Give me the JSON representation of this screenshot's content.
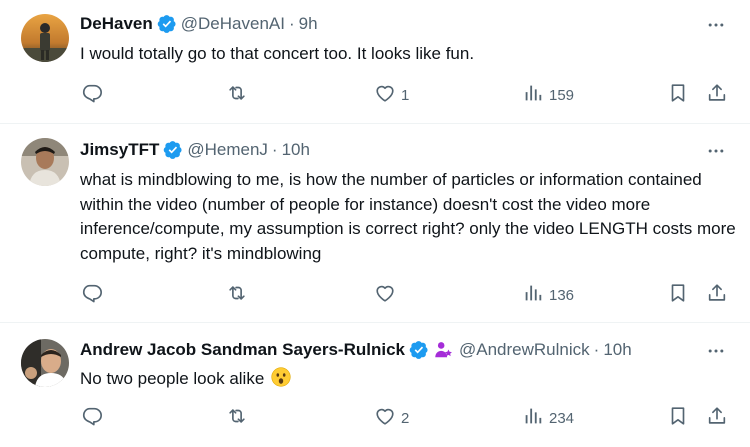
{
  "tweets": [
    {
      "name": "DeHaven",
      "handle": "@DeHavenAI",
      "time": "9h",
      "text": "I would totally go to that concert too. It looks like fun.",
      "likes": "1",
      "views": "159"
    },
    {
      "name": "JimsyTFT",
      "handle": "@HemenJ",
      "time": "10h",
      "text": "what is mindblowing to me, is how the number of particles or information contained within the video (number of people for instance) doesn't cost the video more inference/compute, my assumption is correct right? only the video LENGTH costs more compute, right? it's mindblowing",
      "likes": "",
      "views": "136"
    },
    {
      "name": "Andrew Jacob Sandman Sayers-Rulnick",
      "handle": "@AndrewRulnick",
      "time": "10h",
      "text": "No two people look alike",
      "emoji": "astonished-face",
      "likes": "2",
      "views": "234"
    }
  ],
  "separator": "·",
  "colors": {
    "text": "#0f1419",
    "secondary": "#536471",
    "verified": "#1d9bf0",
    "affiliate": "#a52dd8",
    "divider": "#eff3f4"
  },
  "icons": [
    "verified-badge-icon",
    "more-icon",
    "reply-icon",
    "retweet-icon",
    "like-icon",
    "views-icon",
    "bookmark-icon",
    "share-icon"
  ]
}
